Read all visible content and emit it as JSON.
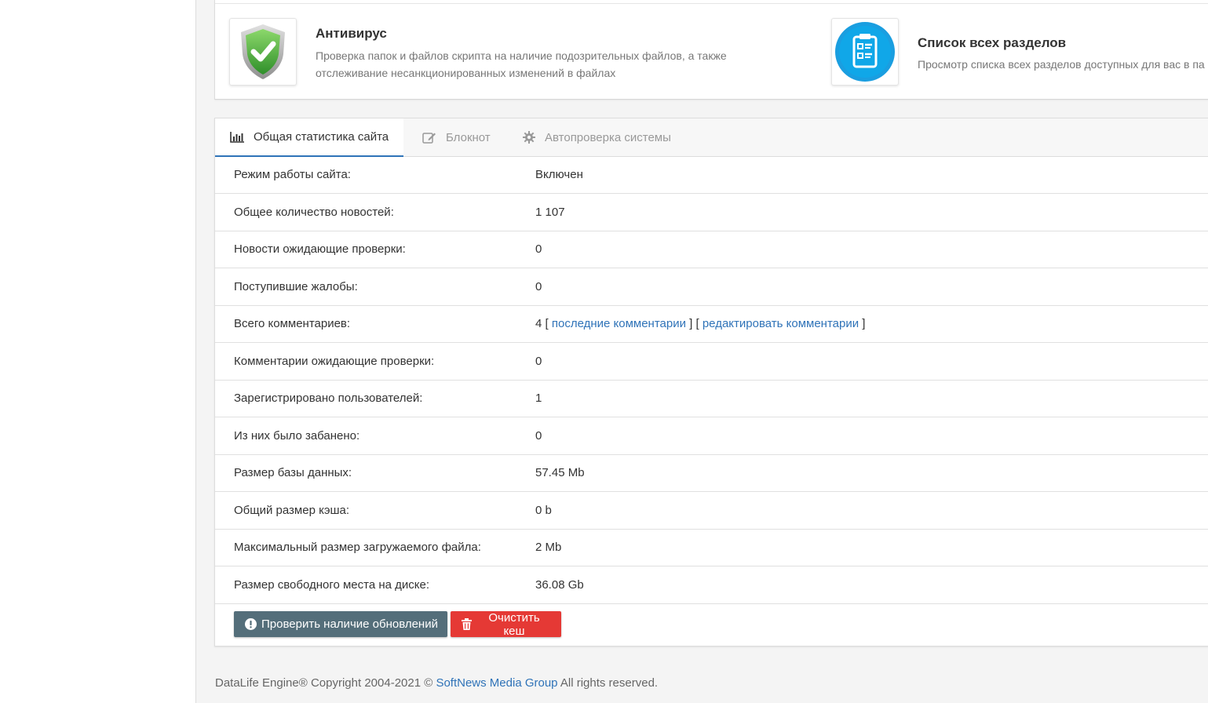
{
  "quick_actions": [
    {
      "title": "Антивирус",
      "desc_line1": "Проверка папок и файлов скрипта на наличие подозрительных файлов, а также",
      "desc_line2": "отслеживание несанкционированных изменений в файлах"
    },
    {
      "title": "Список всех разделов",
      "desc_line1": "Просмотр списка всех разделов доступных для вас в па"
    }
  ],
  "tabs": [
    {
      "label": "Общая статистика сайта",
      "active": true
    },
    {
      "label": "Блокнот",
      "active": false
    },
    {
      "label": "Автопроверка системы",
      "active": false
    }
  ],
  "stats": [
    {
      "label": "Режим работы сайта:",
      "value": "Включен"
    },
    {
      "label": "Общее количество новостей:",
      "value": "1 107"
    },
    {
      "label": "Новости ожидающие проверки:",
      "value": "0"
    },
    {
      "label": "Поступившие жалобы:",
      "value": "0"
    },
    {
      "label": "Всего комментариев:",
      "value": "4",
      "open1": "[",
      "link1": "последние комментарии",
      "mid": "] [",
      "link2": "редактировать комментарии",
      "close": "]"
    },
    {
      "label": "Комментарии ожидающие проверки:",
      "value": "0"
    },
    {
      "label": "Зарегистрировано пользователей:",
      "value": "1"
    },
    {
      "label": "Из них было забанено:",
      "value": "0"
    },
    {
      "label": "Размер базы данных:",
      "value": "57.45 Mb"
    },
    {
      "label": "Общий размер кэша:",
      "value": "0 b"
    },
    {
      "label": "Максимальный размер загружаемого файла:",
      "value": "2 Mb"
    },
    {
      "label": "Размер свободного места на диске:",
      "value": "36.08 Gb"
    }
  ],
  "buttons": {
    "check_updates": "Проверить наличие обновлений",
    "clear_cache": "Очистить кеш"
  },
  "footer": {
    "prefix": "DataLife Engine® Copyright 2004-2021 ©",
    "company": "SoftNews Media Group",
    "suffix": "All rights reserved."
  },
  "colors": {
    "accent": "#2f73b8",
    "update_btn": "#546e7a",
    "cache_btn": "#e53935",
    "banned_value": "#d63c3c"
  },
  "icons": {
    "antivirus": "shield-check-icon",
    "sections": "clipboard-list-icon",
    "stats_tab": "bar-chart-icon",
    "notepad_tab": "edit-icon",
    "autocheck_tab": "gear-icon",
    "update_btn": "exclamation-circle-icon",
    "cache_btn": "trash-icon"
  }
}
